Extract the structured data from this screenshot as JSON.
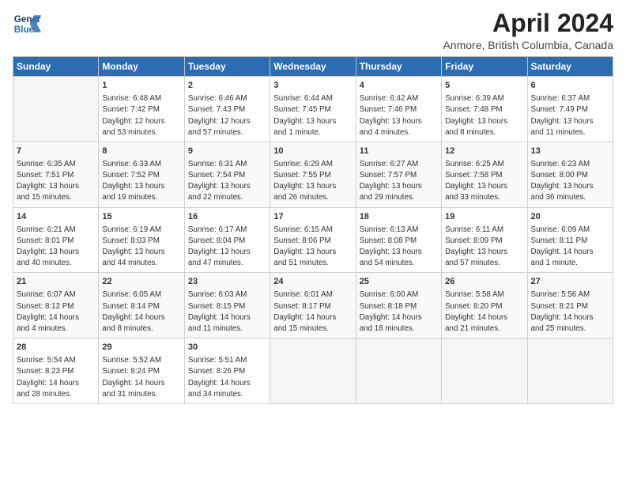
{
  "logo": {
    "line1": "General",
    "line2": "Blue"
  },
  "title": "April 2024",
  "subtitle": "Anmore, British Columbia, Canada",
  "days_of_week": [
    "Sunday",
    "Monday",
    "Tuesday",
    "Wednesday",
    "Thursday",
    "Friday",
    "Saturday"
  ],
  "weeks": [
    [
      {
        "day": "",
        "info": ""
      },
      {
        "day": "1",
        "info": "Sunrise: 6:48 AM\nSunset: 7:42 PM\nDaylight: 12 hours\nand 53 minutes."
      },
      {
        "day": "2",
        "info": "Sunrise: 6:46 AM\nSunset: 7:43 PM\nDaylight: 12 hours\nand 57 minutes."
      },
      {
        "day": "3",
        "info": "Sunrise: 6:44 AM\nSunset: 7:45 PM\nDaylight: 13 hours\nand 1 minute."
      },
      {
        "day": "4",
        "info": "Sunrise: 6:42 AM\nSunset: 7:46 PM\nDaylight: 13 hours\nand 4 minutes."
      },
      {
        "day": "5",
        "info": "Sunrise: 6:39 AM\nSunset: 7:48 PM\nDaylight: 13 hours\nand 8 minutes."
      },
      {
        "day": "6",
        "info": "Sunrise: 6:37 AM\nSunset: 7:49 PM\nDaylight: 13 hours\nand 11 minutes."
      }
    ],
    [
      {
        "day": "7",
        "info": "Sunrise: 6:35 AM\nSunset: 7:51 PM\nDaylight: 13 hours\nand 15 minutes."
      },
      {
        "day": "8",
        "info": "Sunrise: 6:33 AM\nSunset: 7:52 PM\nDaylight: 13 hours\nand 19 minutes."
      },
      {
        "day": "9",
        "info": "Sunrise: 6:31 AM\nSunset: 7:54 PM\nDaylight: 13 hours\nand 22 minutes."
      },
      {
        "day": "10",
        "info": "Sunrise: 6:29 AM\nSunset: 7:55 PM\nDaylight: 13 hours\nand 26 minutes."
      },
      {
        "day": "11",
        "info": "Sunrise: 6:27 AM\nSunset: 7:57 PM\nDaylight: 13 hours\nand 29 minutes."
      },
      {
        "day": "12",
        "info": "Sunrise: 6:25 AM\nSunset: 7:58 PM\nDaylight: 13 hours\nand 33 minutes."
      },
      {
        "day": "13",
        "info": "Sunrise: 6:23 AM\nSunset: 8:00 PM\nDaylight: 13 hours\nand 36 minutes."
      }
    ],
    [
      {
        "day": "14",
        "info": "Sunrise: 6:21 AM\nSunset: 8:01 PM\nDaylight: 13 hours\nand 40 minutes."
      },
      {
        "day": "15",
        "info": "Sunrise: 6:19 AM\nSunset: 8:03 PM\nDaylight: 13 hours\nand 44 minutes."
      },
      {
        "day": "16",
        "info": "Sunrise: 6:17 AM\nSunset: 8:04 PM\nDaylight: 13 hours\nand 47 minutes."
      },
      {
        "day": "17",
        "info": "Sunrise: 6:15 AM\nSunset: 8:06 PM\nDaylight: 13 hours\nand 51 minutes."
      },
      {
        "day": "18",
        "info": "Sunrise: 6:13 AM\nSunset: 8:08 PM\nDaylight: 13 hours\nand 54 minutes."
      },
      {
        "day": "19",
        "info": "Sunrise: 6:11 AM\nSunset: 8:09 PM\nDaylight: 13 hours\nand 57 minutes."
      },
      {
        "day": "20",
        "info": "Sunrise: 6:09 AM\nSunset: 8:11 PM\nDaylight: 14 hours\nand 1 minute."
      }
    ],
    [
      {
        "day": "21",
        "info": "Sunrise: 6:07 AM\nSunset: 8:12 PM\nDaylight: 14 hours\nand 4 minutes."
      },
      {
        "day": "22",
        "info": "Sunrise: 6:05 AM\nSunset: 8:14 PM\nDaylight: 14 hours\nand 8 minutes."
      },
      {
        "day": "23",
        "info": "Sunrise: 6:03 AM\nSunset: 8:15 PM\nDaylight: 14 hours\nand 11 minutes."
      },
      {
        "day": "24",
        "info": "Sunrise: 6:01 AM\nSunset: 8:17 PM\nDaylight: 14 hours\nand 15 minutes."
      },
      {
        "day": "25",
        "info": "Sunrise: 6:00 AM\nSunset: 8:18 PM\nDaylight: 14 hours\nand 18 minutes."
      },
      {
        "day": "26",
        "info": "Sunrise: 5:58 AM\nSunset: 8:20 PM\nDaylight: 14 hours\nand 21 minutes."
      },
      {
        "day": "27",
        "info": "Sunrise: 5:56 AM\nSunset: 8:21 PM\nDaylight: 14 hours\nand 25 minutes."
      }
    ],
    [
      {
        "day": "28",
        "info": "Sunrise: 5:54 AM\nSunset: 8:23 PM\nDaylight: 14 hours\nand 28 minutes."
      },
      {
        "day": "29",
        "info": "Sunrise: 5:52 AM\nSunset: 8:24 PM\nDaylight: 14 hours\nand 31 minutes."
      },
      {
        "day": "30",
        "info": "Sunrise: 5:51 AM\nSunset: 8:26 PM\nDaylight: 14 hours\nand 34 minutes."
      },
      {
        "day": "",
        "info": ""
      },
      {
        "day": "",
        "info": ""
      },
      {
        "day": "",
        "info": ""
      },
      {
        "day": "",
        "info": ""
      }
    ]
  ]
}
